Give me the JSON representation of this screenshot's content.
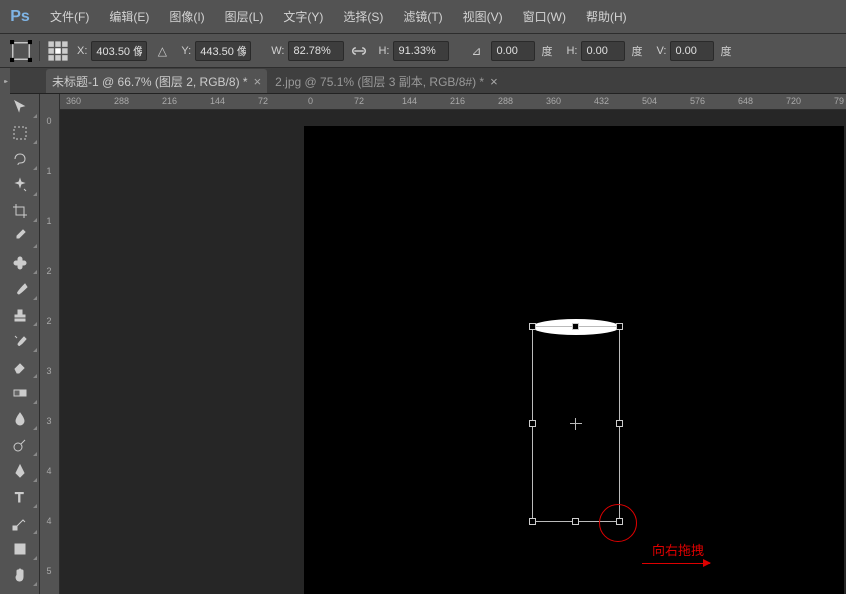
{
  "menubar": {
    "items": [
      "文件(F)",
      "编辑(E)",
      "图像(I)",
      "图层(L)",
      "文字(Y)",
      "选择(S)",
      "滤镜(T)",
      "视图(V)",
      "窗口(W)",
      "帮助(H)"
    ]
  },
  "options": {
    "x_label": "X:",
    "x_value": "403.50 像",
    "y_label": "Y:",
    "y_value": "443.50 像",
    "w_label": "W:",
    "w_value": "82.78%",
    "h_label": "H:",
    "h_value": "91.33%",
    "rot_value": "0.00",
    "rot_unit": "度",
    "sh_label": "H:",
    "sh_value": "0.00",
    "sh_unit": "度",
    "sv_label": "V:",
    "sv_value": "0.00",
    "sv_unit": "度"
  },
  "tabs": {
    "active": "未标题-1 @ 66.7% (图层 2, RGB/8) *",
    "inactive": "2.jpg @ 75.1% (图层 3 副本, RGB/8#) *"
  },
  "ruler_h": [
    {
      "v": "360",
      "p": 66
    },
    {
      "v": "288",
      "p": 114
    },
    {
      "v": "216",
      "p": 162
    },
    {
      "v": "144",
      "p": 210
    },
    {
      "v": "72",
      "p": 258
    },
    {
      "v": "0",
      "p": 308
    },
    {
      "v": "72",
      "p": 354
    },
    {
      "v": "144",
      "p": 402
    },
    {
      "v": "216",
      "p": 450
    },
    {
      "v": "288",
      "p": 498
    },
    {
      "v": "360",
      "p": 546
    },
    {
      "v": "432",
      "p": 594
    },
    {
      "v": "504",
      "p": 642
    },
    {
      "v": "576",
      "p": 690
    },
    {
      "v": "648",
      "p": 738
    },
    {
      "v": "720",
      "p": 786
    },
    {
      "v": "79",
      "p": 834
    }
  ],
  "ruler_v": [
    {
      "v": "0",
      "p": 22
    },
    {
      "v": "1",
      "p": 72
    },
    {
      "v": "1",
      "p": 122
    },
    {
      "v": "2",
      "p": 172
    },
    {
      "v": "2",
      "p": 222
    },
    {
      "v": "3",
      "p": 272
    },
    {
      "v": "3",
      "p": 322
    },
    {
      "v": "4",
      "p": 372
    },
    {
      "v": "4",
      "p": 422
    },
    {
      "v": "5",
      "p": 472
    }
  ],
  "annotation": {
    "text": "向右拖拽"
  }
}
